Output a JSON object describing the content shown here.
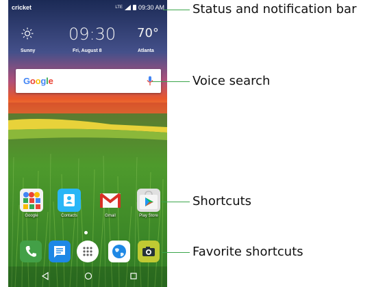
{
  "status_bar": {
    "carrier": "cricket",
    "network": "LTE",
    "time": "09:30 AM"
  },
  "clock_widget": {
    "weather": "Sunny",
    "time": "09:30",
    "date": "Fri, August 8",
    "temperature": "70°",
    "city": "Atlanta",
    "weather_icon": "sun-icon"
  },
  "search_bar": {
    "logo": "Google",
    "mic_icon": "mic-icon"
  },
  "shortcuts": [
    {
      "label": "Google",
      "icon": "google-folder-icon"
    },
    {
      "label": "Contacts",
      "icon": "contacts-icon"
    },
    {
      "label": "Gmail",
      "icon": "gmail-icon"
    },
    {
      "label": "Play Store",
      "icon": "play-store-icon"
    }
  ],
  "favorites": [
    {
      "icon": "phone-icon",
      "color": "#43a047"
    },
    {
      "icon": "messaging-icon",
      "color": "#1e88e5"
    },
    {
      "icon": "app-drawer-icon",
      "color": "#ffffff"
    },
    {
      "icon": "browser-icon",
      "color": "#ffffff"
    },
    {
      "icon": "camera-icon",
      "color": "#c0ca33"
    }
  ],
  "nav_buttons": [
    "back-icon",
    "home-icon",
    "recents-icon"
  ],
  "callouts": [
    {
      "label": "Status and notification bar"
    },
    {
      "label": "Voice search"
    },
    {
      "label": "Shortcuts"
    },
    {
      "label": "Favorite shortcuts"
    }
  ],
  "colors": {
    "callout_line": "#3aa54a",
    "sky_top": "#1b2a55",
    "sunset": "#e8582a",
    "grass": "#3f8f2c"
  }
}
